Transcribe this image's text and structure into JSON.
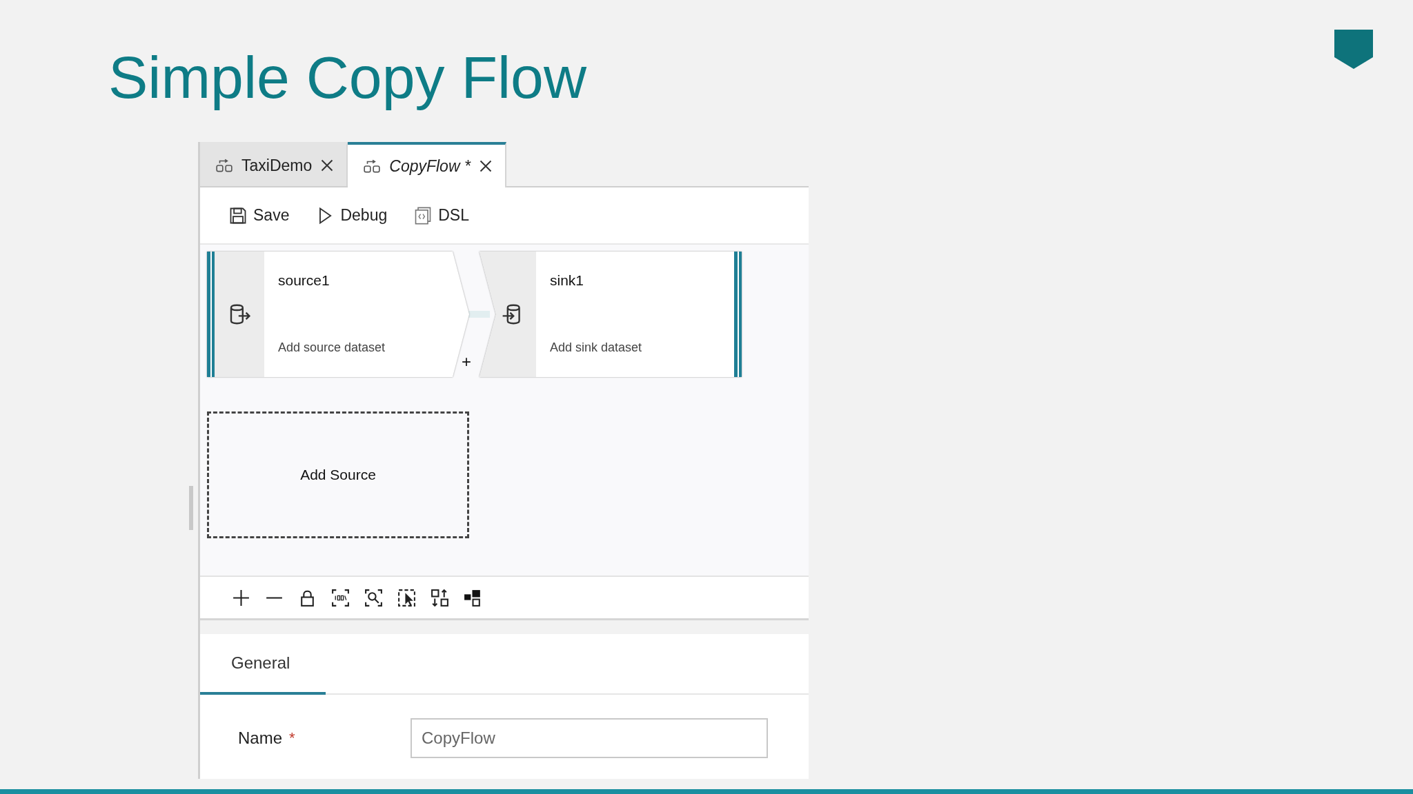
{
  "slide": {
    "title": "Simple Copy Flow"
  },
  "tabs": [
    {
      "label": "TaxiDemo",
      "selected": false,
      "modified": false
    },
    {
      "label": "CopyFlow *",
      "selected": true,
      "modified": true
    }
  ],
  "toolbar": [
    {
      "kind": "save",
      "label": "Save"
    },
    {
      "kind": "debug",
      "label": "Debug"
    },
    {
      "kind": "dsl",
      "label": "DSL"
    }
  ],
  "nodes": [
    {
      "kind": "source",
      "name": "source1",
      "hint": "Add source dataset"
    },
    {
      "kind": "sink",
      "name": "sink1",
      "hint": "Add sink dataset"
    }
  ],
  "connector_add": "+",
  "add_source": "Add Source",
  "zoom_tools": [
    {
      "kind": "zoom-in"
    },
    {
      "kind": "zoom-out"
    },
    {
      "kind": "lock"
    },
    {
      "kind": "actual-size"
    },
    {
      "kind": "zoom-fit"
    },
    {
      "kind": "select"
    },
    {
      "kind": "arrange"
    },
    {
      "kind": "minimap"
    }
  ],
  "properties": {
    "tabs": [
      {
        "label": "General",
        "selected": true
      }
    ],
    "fields": [
      {
        "label": "Name",
        "required_mark": "*",
        "value": "CopyFlow"
      }
    ]
  }
}
